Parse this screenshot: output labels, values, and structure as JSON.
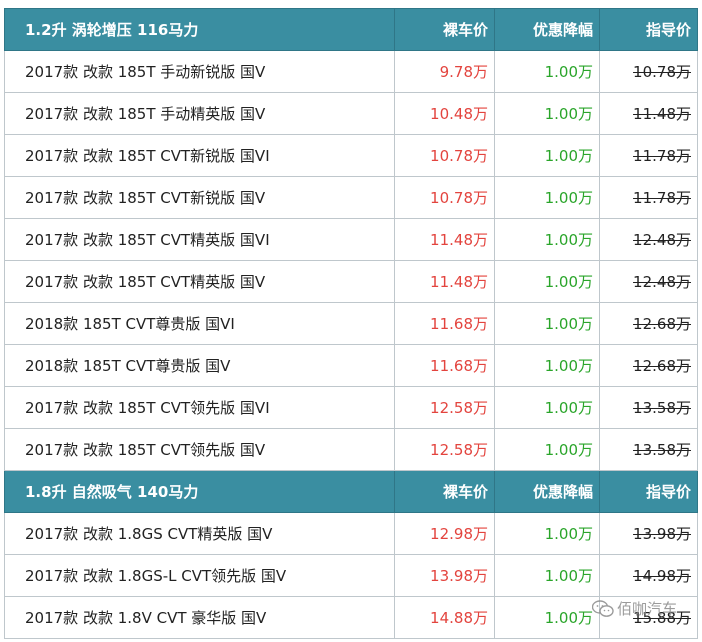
{
  "sections": [
    {
      "title": "1.2升 涡轮增压 116马力",
      "headers": {
        "bare": "裸车价",
        "discount": "优惠降幅",
        "guide": "指导价"
      },
      "rows": [
        {
          "model": "2017款 改款 185T 手动新锐版 国V",
          "bare": "9.78万",
          "discount": "1.00万",
          "guide": "10.78万"
        },
        {
          "model": "2017款 改款 185T 手动精英版 国V",
          "bare": "10.48万",
          "discount": "1.00万",
          "guide": "11.48万"
        },
        {
          "model": "2017款 改款 185T CVT新锐版 国VI",
          "bare": "10.78万",
          "discount": "1.00万",
          "guide": "11.78万"
        },
        {
          "model": "2017款 改款 185T CVT新锐版 国V",
          "bare": "10.78万",
          "discount": "1.00万",
          "guide": "11.78万"
        },
        {
          "model": "2017款 改款 185T CVT精英版 国VI",
          "bare": "11.48万",
          "discount": "1.00万",
          "guide": "12.48万"
        },
        {
          "model": "2017款 改款 185T CVT精英版 国V",
          "bare": "11.48万",
          "discount": "1.00万",
          "guide": "12.48万"
        },
        {
          "model": "2018款 185T CVT尊贵版 国VI",
          "bare": "11.68万",
          "discount": "1.00万",
          "guide": "12.68万"
        },
        {
          "model": "2018款 185T CVT尊贵版 国V",
          "bare": "11.68万",
          "discount": "1.00万",
          "guide": "12.68万"
        },
        {
          "model": "2017款 改款 185T CVT领先版 国VI",
          "bare": "12.58万",
          "discount": "1.00万",
          "guide": "13.58万"
        },
        {
          "model": "2017款 改款 185T CVT领先版 国V",
          "bare": "12.58万",
          "discount": "1.00万",
          "guide": "13.58万"
        }
      ]
    },
    {
      "title": "1.8升 自然吸气 140马力",
      "headers": {
        "bare": "裸车价",
        "discount": "优惠降幅",
        "guide": "指导价"
      },
      "rows": [
        {
          "model": "2017款 改款 1.8GS CVT精英版 国V",
          "bare": "12.98万",
          "discount": "1.00万",
          "guide": "13.98万"
        },
        {
          "model": "2017款 改款 1.8GS-L CVT领先版 国V",
          "bare": "13.98万",
          "discount": "1.00万",
          "guide": "14.98万"
        },
        {
          "model": "2017款 改款 1.8V CVT 豪华版 国V",
          "bare": "14.88万",
          "discount": "1.00万",
          "guide": "15.88万"
        }
      ]
    }
  ],
  "watermark": {
    "text": "佰咖汽车",
    "icon": "wechat-icon"
  },
  "colors": {
    "header_bg": "#3a8ea1",
    "bare_price": "#e3443e",
    "discount": "#2aa52a",
    "border": "#bfc7cc"
  }
}
